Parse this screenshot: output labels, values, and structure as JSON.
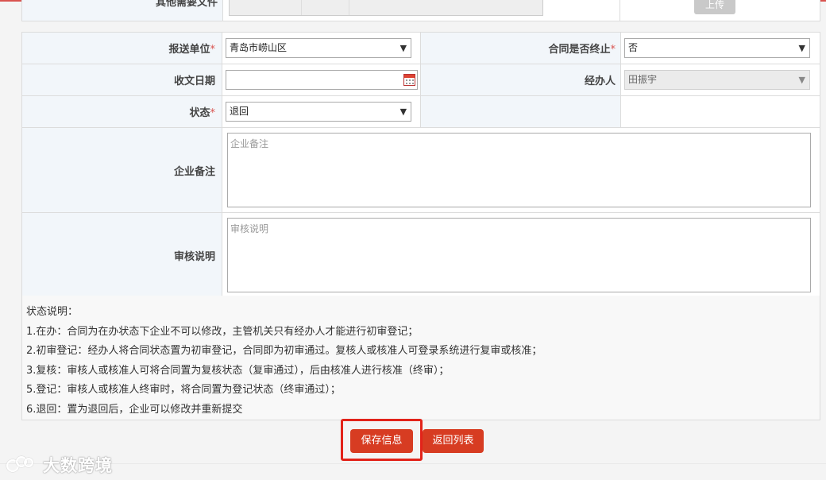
{
  "upload_row": {
    "label": "其他需要文件",
    "button": "上传"
  },
  "form": {
    "report_unit": {
      "label": "报送单位",
      "value": "青岛市崂山区"
    },
    "contract_terminated": {
      "label": "合同是否终止",
      "value": "否"
    },
    "receipt_date": {
      "label": "收文日期",
      "value": ""
    },
    "handler": {
      "label": "经办人",
      "value": "田振宇"
    },
    "status": {
      "label": "状态",
      "value": "退回"
    },
    "enterprise_note": {
      "label": "企业备注",
      "placeholder": "企业备注"
    },
    "review_note": {
      "label": "审核说明",
      "placeholder": "审核说明"
    }
  },
  "status_notes": {
    "title": "状态说明：",
    "lines": [
      "1.在办：合同为在办状态下企业不可以修改，主管机关只有经办人才能进行初审登记；",
      "2.初审登记：经办人将合同状态置为初审登记，合同即为初审通过。复核人或核准人可登录系统进行复审或核准；",
      "3.复核：审核人或核准人可将合同置为复核状态（复审通过），后由核准人进行核准（终审）；",
      "5.登记：审核人或核准人终审时，将合同置为登记状态（终审通过）；",
      "6.退回：置为退回后，企业可以修改并重新提交"
    ]
  },
  "buttons": {
    "save": "保存信息",
    "back": "返回列表"
  },
  "watermark": "大数跨境",
  "colors": {
    "accent": "#d73c22",
    "highlight": "#e2231a",
    "label_bg": "#f2f6fa",
    "required": "#d9534f"
  },
  "icons": {
    "calendar": "calendar-icon",
    "dropdown": "chevron-down-icon"
  }
}
